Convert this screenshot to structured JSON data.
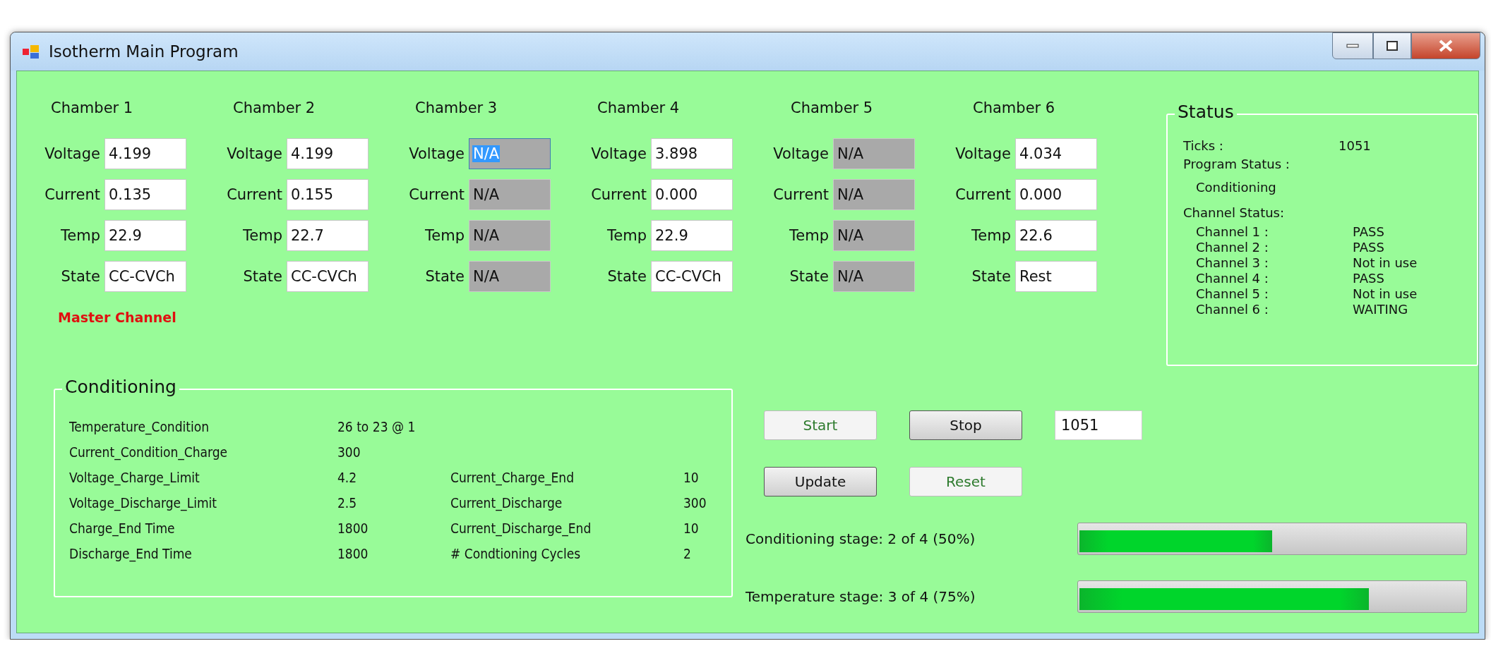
{
  "window": {
    "title": "Isotherm Main Program"
  },
  "chambers": [
    {
      "label": "Chamber 1",
      "note": "Master Channel",
      "fields": [
        {
          "label": "Voltage",
          "value": "4.199",
          "disabled": false,
          "focused": false
        },
        {
          "label": "Current",
          "value": "0.135",
          "disabled": false,
          "focused": false
        },
        {
          "label": "Temp",
          "value": "22.9",
          "disabled": false,
          "focused": false
        },
        {
          "label": "State",
          "value": "CC-CVCh",
          "disabled": false,
          "focused": false
        }
      ]
    },
    {
      "label": "Chamber 2",
      "fields": [
        {
          "label": "Voltage",
          "value": "4.199",
          "disabled": false,
          "focused": false
        },
        {
          "label": "Current",
          "value": "0.155",
          "disabled": false,
          "focused": false
        },
        {
          "label": "Temp",
          "value": "22.7",
          "disabled": false,
          "focused": false
        },
        {
          "label": "State",
          "value": "CC-CVCh",
          "disabled": false,
          "focused": false
        }
      ]
    },
    {
      "label": "Chamber 3",
      "fields": [
        {
          "label": "Voltage",
          "value": "N/A",
          "disabled": true,
          "focused": true
        },
        {
          "label": "Current",
          "value": "N/A",
          "disabled": true,
          "focused": false
        },
        {
          "label": "Temp",
          "value": "N/A",
          "disabled": true,
          "focused": false
        },
        {
          "label": "State",
          "value": "N/A",
          "disabled": true,
          "focused": false
        }
      ]
    },
    {
      "label": "Chamber 4",
      "fields": [
        {
          "label": "Voltage",
          "value": "3.898",
          "disabled": false,
          "focused": false
        },
        {
          "label": "Current",
          "value": "0.000",
          "disabled": false,
          "focused": false
        },
        {
          "label": "Temp",
          "value": "22.9",
          "disabled": false,
          "focused": false
        },
        {
          "label": "State",
          "value": "CC-CVCh",
          "disabled": false,
          "focused": false
        }
      ]
    },
    {
      "label": "Chamber 5",
      "fields": [
        {
          "label": "Voltage",
          "value": "N/A",
          "disabled": true,
          "focused": false
        },
        {
          "label": "Current",
          "value": "N/A",
          "disabled": true,
          "focused": false
        },
        {
          "label": "Temp",
          "value": "N/A",
          "disabled": true,
          "focused": false
        },
        {
          "label": "State",
          "value": "N/A",
          "disabled": true,
          "focused": false
        }
      ]
    },
    {
      "label": "Chamber 6",
      "fields": [
        {
          "label": "Voltage",
          "value": "4.034",
          "disabled": false,
          "focused": false
        },
        {
          "label": "Current",
          "value": "0.000",
          "disabled": false,
          "focused": false
        },
        {
          "label": "Temp",
          "value": "22.6",
          "disabled": false,
          "focused": false
        },
        {
          "label": "State",
          "value": "Rest",
          "disabled": false,
          "focused": false
        }
      ]
    }
  ],
  "status": {
    "title": "Status",
    "ticks_label": "Ticks :",
    "ticks_value": "1051",
    "program_status_label": "Program Status :",
    "program_status_value": "Conditioning",
    "channel_status_label": "Channel Status:",
    "channels": [
      {
        "name": "Channel 1 :",
        "status": "PASS"
      },
      {
        "name": "Channel 2 :",
        "status": "PASS"
      },
      {
        "name": "Channel 3 :",
        "status": "Not in use"
      },
      {
        "name": "Channel 4 :",
        "status": "PASS"
      },
      {
        "name": "Channel 5 :",
        "status": "Not in use"
      },
      {
        "name": "Channel 6 :",
        "status": "WAITING"
      }
    ]
  },
  "conditioning": {
    "title": "Conditioning",
    "left": [
      {
        "name": "Temperature_Condition",
        "value": "26 to 23 @ 1"
      },
      {
        "name": "Current_Condition_Charge",
        "value": "300"
      },
      {
        "name": "Voltage_Charge_Limit",
        "value": "4.2"
      },
      {
        "name": "Voltage_Discharge_Limit",
        "value": "2.5"
      },
      {
        "name": "Charge_End Time",
        "value": "1800"
      },
      {
        "name": "Discharge_End Time",
        "value": "1800"
      }
    ],
    "right": [
      {
        "name": "Current_Charge_End",
        "value": "10"
      },
      {
        "name": "Current_Discharge",
        "value": "300"
      },
      {
        "name": "Current_Discharge_End",
        "value": "10"
      },
      {
        "name": "# Condtioning Cycles",
        "value": "2"
      }
    ]
  },
  "buttons": [
    {
      "label": "Start",
      "disabled": true
    },
    {
      "label": "Stop",
      "disabled": false
    },
    {
      "label": "Update",
      "disabled": false
    },
    {
      "label": "Reset",
      "disabled": true
    }
  ],
  "ticks_field": {
    "value": "1051"
  },
  "progress": [
    {
      "label": "Conditioning stage: 2 of 4 (50%)",
      "level": 0.5
    },
    {
      "label": "Temperature stage: 3 of 4 (75%)",
      "level": 0.75
    }
  ]
}
